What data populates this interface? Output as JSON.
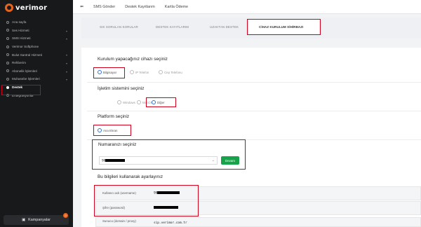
{
  "brand": {
    "name": "verimor"
  },
  "sidebar": {
    "items": [
      {
        "label": "Ana sayfa",
        "icon": "home-icon",
        "has_chevron": false
      },
      {
        "label": "Ses Hizmeti",
        "icon": "phone-icon",
        "has_chevron": true
      },
      {
        "label": "SMS Hizmeti",
        "icon": "message-icon",
        "has_chevron": true
      },
      {
        "label": "Verimor Softphone",
        "icon": "headset-icon",
        "has_chevron": false
      },
      {
        "label": "Bulut Santral Hizmeti",
        "icon": "cloud-icon",
        "has_chevron": true
      },
      {
        "label": "Rehberim",
        "icon": "contacts-icon",
        "has_chevron": true
      },
      {
        "label": "Abonelik İşlemleri",
        "icon": "user-icon",
        "has_chevron": true
      },
      {
        "label": "Muhasebe İşlemleri",
        "icon": "wallet-icon",
        "has_chevron": true
      },
      {
        "label": "Destek",
        "icon": "support-icon",
        "has_chevron": false,
        "active": true
      },
      {
        "label": "Entegrasyonlar",
        "icon": "plug-icon",
        "has_chevron": false
      }
    ],
    "campaign_label": "Kampanyalar",
    "campaign_badge": "0"
  },
  "topbar": {
    "links": [
      "SMS Gönder",
      "Destek Kayıtlarım",
      "Kartla Ödeme"
    ]
  },
  "tabs": [
    {
      "label": "SIK SORULAN SORULAR"
    },
    {
      "label": "DESTEK KAYITLARIM"
    },
    {
      "label": "UZAKTAN DESTEK"
    },
    {
      "label": "CİHAZ KURULUM SİHİRBAZI",
      "active": true
    }
  ],
  "form": {
    "device_title": "Kurulum yapacağınız cihazı seçiniz",
    "device_options": [
      "Bilgisayar",
      "IP Telefon",
      "Cep Telefonu"
    ],
    "device_selected": "Bilgisayar",
    "os_title": "İşletim sistemini seçiniz",
    "os_options": [
      "Windows",
      "MacOS",
      "Diğer"
    ],
    "os_selected": "Diğer",
    "platform_title": "Platform seçiniz",
    "platform_options": [
      "Ana Ekran"
    ],
    "platform_selected": "Ana Ekran",
    "number_title": "Numaranızı seçiniz",
    "number_value_prefix": "90",
    "continue_button": "Devam",
    "info_title": "Bu bilgileri kullanarak ayarlayınız",
    "username_label": "Kullanıcı adı (username)",
    "username_prefix": "90",
    "password_label": "Şifre (password)",
    "server_label": "Sunucu (domain / proxy)",
    "server_value": "sip.verimor.com.tr"
  },
  "colors": {
    "accent_orange": "#e8641e",
    "highlight_red": "#d0021b",
    "radio_blue": "#2f74d0",
    "button_green": "#16a34a"
  }
}
